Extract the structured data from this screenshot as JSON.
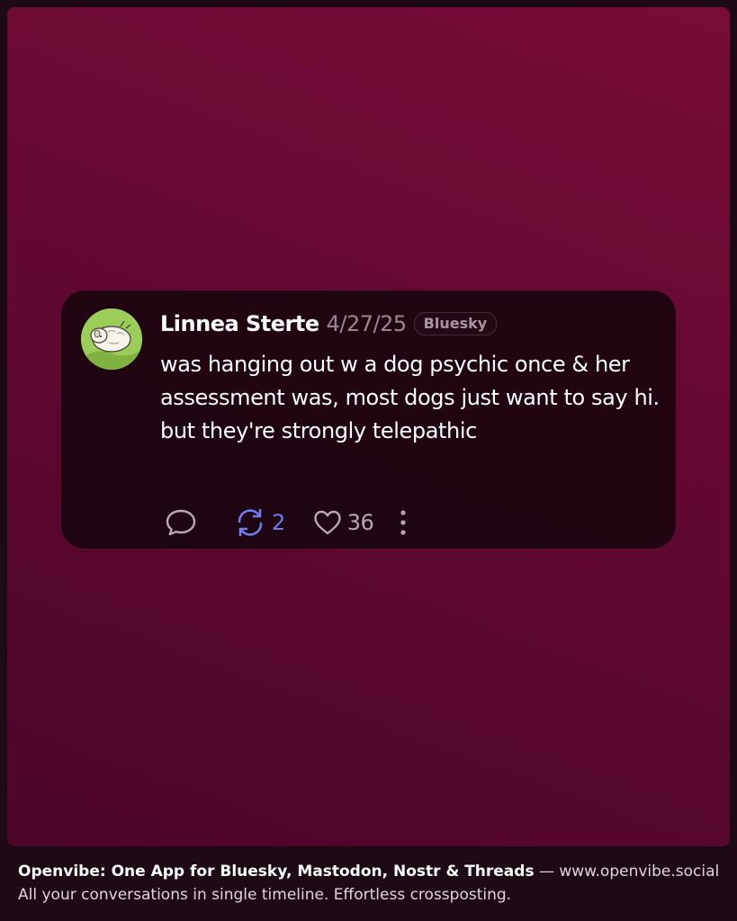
{
  "post": {
    "author": "Linnea Sterte",
    "date": "4/27/25",
    "network": "Bluesky",
    "text": "was hanging out w a dog psychic once & her assessment was, most dogs just want to say hi. but they're strongly telepathic",
    "avatar_icon": "dog-illustration-avatar",
    "actions": {
      "reply_icon": "speech-bubble-icon",
      "repost_icon": "repost-arrows-icon",
      "repost_count": "2",
      "like_icon": "heart-icon",
      "like_count": "36",
      "more_icon": "vertical-ellipsis-icon"
    }
  },
  "footer": {
    "title": "Openvibe: One App for Bluesky, Mastodon, Nostr & Threads",
    "separator": " — ",
    "url": "www.openvibe.social",
    "tagline": "All your conversations in single timeline. Effortless crossposting."
  },
  "colors": {
    "background_top": "#780c35",
    "background_bottom": "#4c0628",
    "card": "#1c0610",
    "repost_accent": "#6e7cf2",
    "avatar_bg": "#9ccd58"
  }
}
